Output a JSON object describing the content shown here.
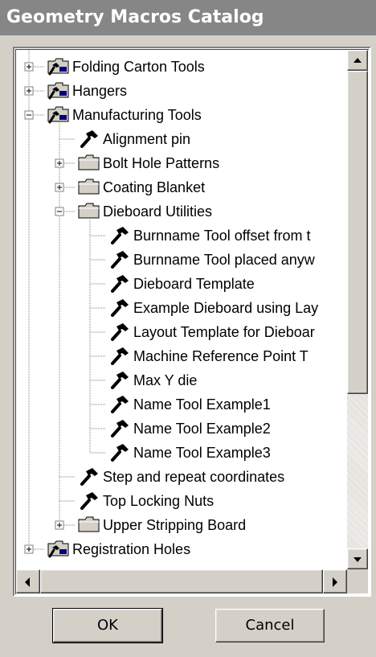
{
  "window": {
    "title": "Geometry Macros Catalog"
  },
  "tree": {
    "rows": [
      {
        "label": "Folding Carton Tools",
        "icon": "macro-folder-icon",
        "indent": 0,
        "expander": "plus"
      },
      {
        "label": "Hangers",
        "icon": "macro-folder-icon",
        "indent": 0,
        "expander": "plus"
      },
      {
        "label": "Manufacturing Tools",
        "icon": "macro-folder-icon",
        "indent": 0,
        "expander": "minus"
      },
      {
        "label": "Alignment pin",
        "icon": "hammer-icon",
        "indent": 1,
        "expander": "none"
      },
      {
        "label": "Bolt Hole Patterns",
        "icon": "folder-icon",
        "indent": 1,
        "expander": "plus"
      },
      {
        "label": "Coating Blanket",
        "icon": "folder-icon",
        "indent": 1,
        "expander": "plus"
      },
      {
        "label": "Dieboard Utilities",
        "icon": "folder-icon",
        "indent": 1,
        "expander": "minus"
      },
      {
        "label": "Burnname Tool offset from t",
        "icon": "hammer-icon",
        "indent": 2,
        "expander": "none"
      },
      {
        "label": "Burnname Tool placed anyw",
        "icon": "hammer-icon",
        "indent": 2,
        "expander": "none"
      },
      {
        "label": "Dieboard Template",
        "icon": "hammer-icon",
        "indent": 2,
        "expander": "none"
      },
      {
        "label": "Example Dieboard using Lay",
        "icon": "hammer-icon",
        "indent": 2,
        "expander": "none"
      },
      {
        "label": "Layout Template for Dieboar",
        "icon": "hammer-icon",
        "indent": 2,
        "expander": "none"
      },
      {
        "label": "Machine Reference Point T",
        "icon": "hammer-icon",
        "indent": 2,
        "expander": "none"
      },
      {
        "label": "Max Y die",
        "icon": "hammer-icon",
        "indent": 2,
        "expander": "none"
      },
      {
        "label": "Name Tool Example1",
        "icon": "hammer-icon",
        "indent": 2,
        "expander": "none"
      },
      {
        "label": "Name Tool Example2",
        "icon": "hammer-icon",
        "indent": 2,
        "expander": "none"
      },
      {
        "label": "Name Tool Example3",
        "icon": "hammer-icon",
        "indent": 2,
        "expander": "none"
      },
      {
        "label": "Step and repeat coordinates",
        "icon": "hammer-icon",
        "indent": 1,
        "expander": "none"
      },
      {
        "label": "Top Locking Nuts",
        "icon": "hammer-icon",
        "indent": 1,
        "expander": "none"
      },
      {
        "label": "Upper Stripping Board",
        "icon": "folder-icon",
        "indent": 1,
        "expander": "plus"
      },
      {
        "label": "Registration Holes",
        "icon": "macro-folder-icon",
        "indent": 0,
        "expander": "plus"
      }
    ]
  },
  "scrollbars": {
    "vertical": {
      "up": "scroll-up-arrow",
      "down": "scroll-down-arrow"
    },
    "horizontal": {
      "left": "scroll-left-arrow",
      "right": "scroll-right-arrow"
    }
  },
  "buttons": {
    "ok_label": "OK",
    "cancel_label": "Cancel"
  },
  "colors": {
    "title_bar": "#868686",
    "dialog_face": "#d4d0c8",
    "folder_fill": "#d4d0c8",
    "macro_folder_accent": "#000080"
  }
}
